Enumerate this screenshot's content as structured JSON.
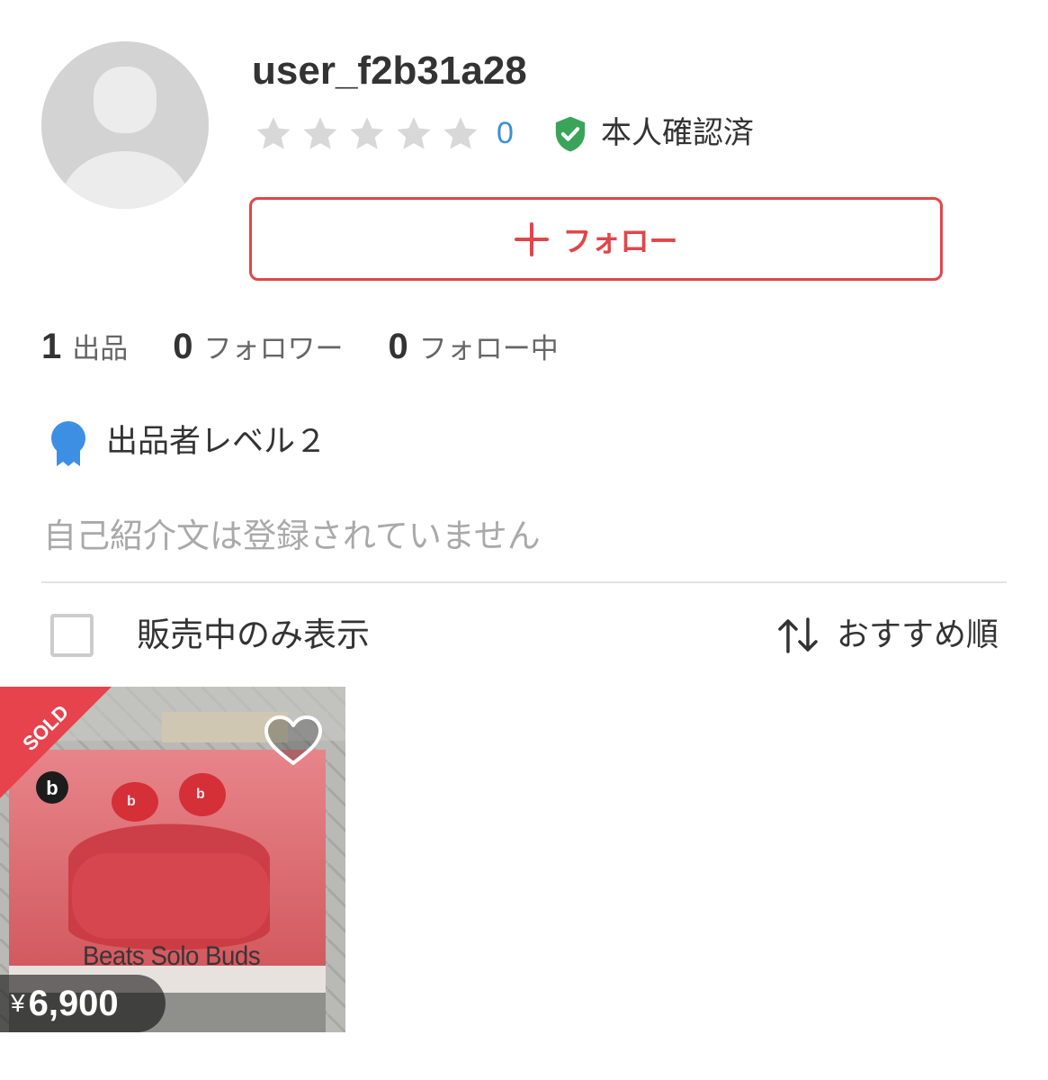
{
  "profile": {
    "username": "user_f2b31a28",
    "rating_count": "0",
    "verified_label": "本人確認済",
    "follow_label": "フォロー"
  },
  "stats": [
    {
      "count": "1",
      "label": "出品"
    },
    {
      "count": "0",
      "label": "フォロワー"
    },
    {
      "count": "0",
      "label": "フォロー中"
    }
  ],
  "seller_level": "出品者レベル２",
  "bio": "自己紹介文は登録されていません",
  "filter": {
    "label": "販売中のみ表示",
    "checked": false
  },
  "sort": {
    "label": "おすすめ順"
  },
  "items": [
    {
      "badge": "SOLD",
      "currency": "¥",
      "price": "6,900",
      "box_text": "Beats Solo Buds"
    }
  ],
  "colors": {
    "accent": "#e0464a",
    "rating_blue": "#3a8fd6",
    "verified_green": "#3aa45a",
    "level_blue": "#3d8fe3",
    "star_gray": "#d8d8d8"
  },
  "icons": {
    "stars": [
      "star-icon",
      "star-icon",
      "star-icon",
      "star-icon",
      "star-icon"
    ],
    "verified": "shield-check-icon",
    "follow": "plus-icon",
    "level": "award-badge-icon",
    "sort": "sort-arrows-icon",
    "like": "heart-icon"
  }
}
